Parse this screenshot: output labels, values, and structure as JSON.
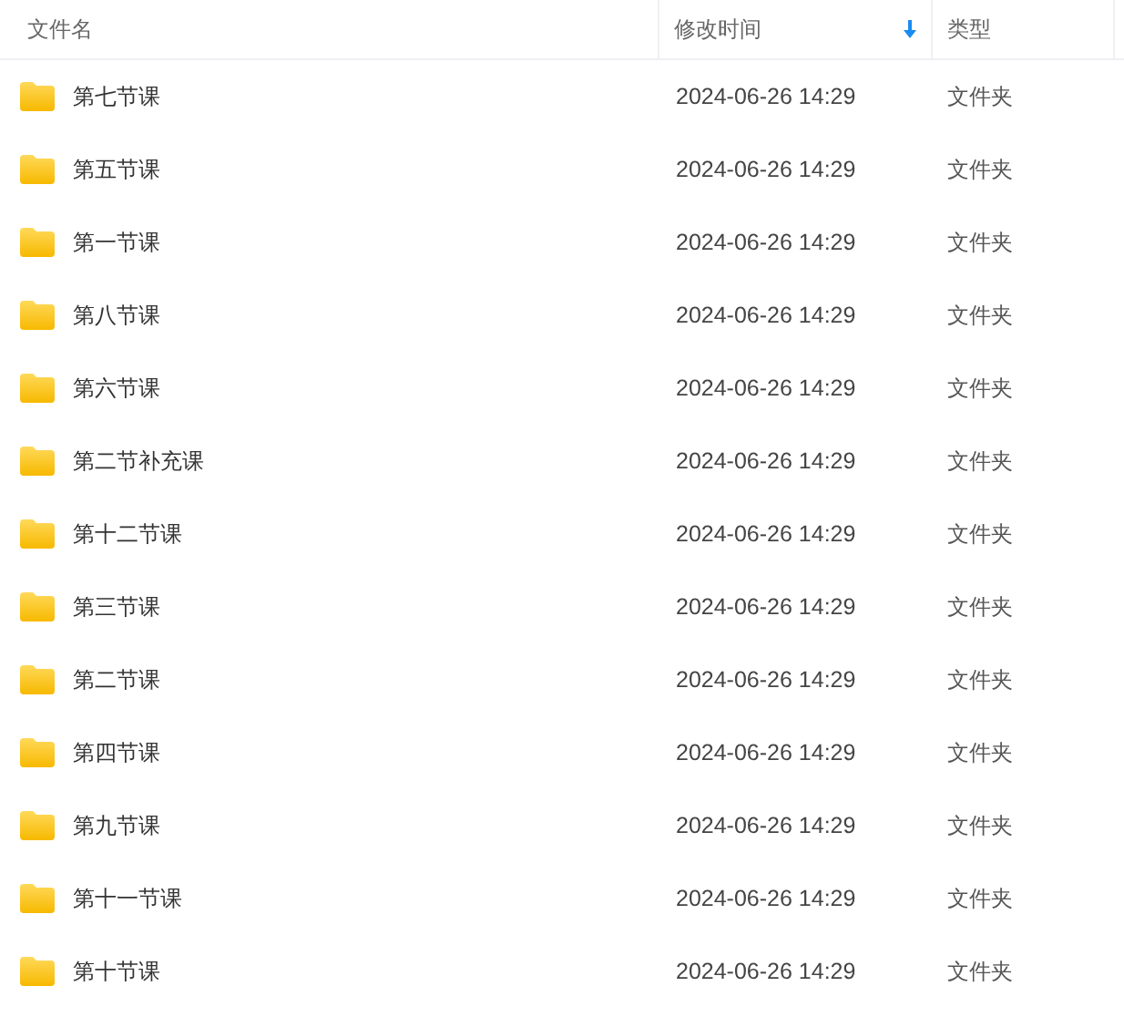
{
  "table": {
    "columns": [
      {
        "label": "文件名",
        "sorted": false
      },
      {
        "label": "修改时间",
        "sorted": true
      },
      {
        "label": "类型",
        "sorted": false
      }
    ],
    "rows": [
      {
        "name": "第七节课",
        "modified": "2024-06-26 14:29",
        "type": "文件夹"
      },
      {
        "name": "第五节课",
        "modified": "2024-06-26 14:29",
        "type": "文件夹"
      },
      {
        "name": "第一节课",
        "modified": "2024-06-26 14:29",
        "type": "文件夹"
      },
      {
        "name": "第八节课",
        "modified": "2024-06-26 14:29",
        "type": "文件夹"
      },
      {
        "name": "第六节课",
        "modified": "2024-06-26 14:29",
        "type": "文件夹"
      },
      {
        "name": "第二节补充课",
        "modified": "2024-06-26 14:29",
        "type": "文件夹"
      },
      {
        "name": "第十二节课",
        "modified": "2024-06-26 14:29",
        "type": "文件夹"
      },
      {
        "name": "第三节课",
        "modified": "2024-06-26 14:29",
        "type": "文件夹"
      },
      {
        "name": "第二节课",
        "modified": "2024-06-26 14:29",
        "type": "文件夹"
      },
      {
        "name": "第四节课",
        "modified": "2024-06-26 14:29",
        "type": "文件夹"
      },
      {
        "name": "第九节课",
        "modified": "2024-06-26 14:29",
        "type": "文件夹"
      },
      {
        "name": "第十一节课",
        "modified": "2024-06-26 14:29",
        "type": "文件夹"
      },
      {
        "name": "第十节课",
        "modified": "2024-06-26 14:29",
        "type": "文件夹"
      }
    ]
  }
}
